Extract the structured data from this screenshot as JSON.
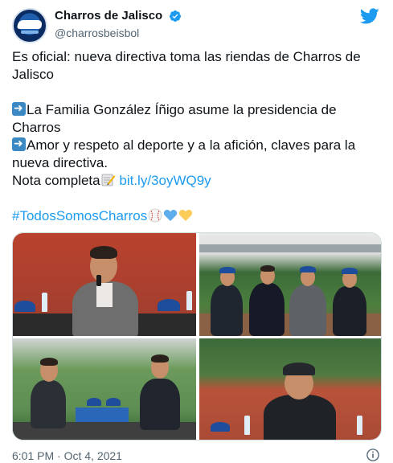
{
  "tweet": {
    "author": {
      "display_name": "Charros de Jalisco",
      "handle": "@charrosbeisbol",
      "verified_icon": "verified-badge-icon",
      "avatar_icon": "charros-logo"
    },
    "platform_icon": "twitter-bird-icon",
    "text": {
      "line1": "Es oficial: nueva directiva toma las riendas de Charros de Jalisco",
      "bullet1": "La Familia González Íñigo asume la presidencia de Charros",
      "bullet2": "Amor y respeto al deporte y a la afición, claves para la nueva directiva.",
      "nota_label": "Nota completa",
      "link": "bit.ly/3oyWQ9y",
      "hashtag": "#TodosSomosCharros"
    },
    "emojis": {
      "arrow": "right-arrow-emoji",
      "memo": "memo-emoji",
      "baseball": "baseball-emoji",
      "blue_heart": "blue-heart-emoji",
      "yellow_heart": "yellow-heart-emoji"
    },
    "photos": [
      {
        "label": "Man speaking into microphone seated at press table"
      },
      {
        "label": "Four men posing on baseball field"
      },
      {
        "label": "Two men seated on stage at stadium"
      },
      {
        "label": "Man in cap smiling at press conference"
      }
    ],
    "timestamp": "6:01 PM · Oct 4, 2021",
    "info_icon": "info-icon",
    "colors": {
      "link": "#1d9bf0",
      "text": "#0f1419",
      "muted": "#536471"
    }
  }
}
